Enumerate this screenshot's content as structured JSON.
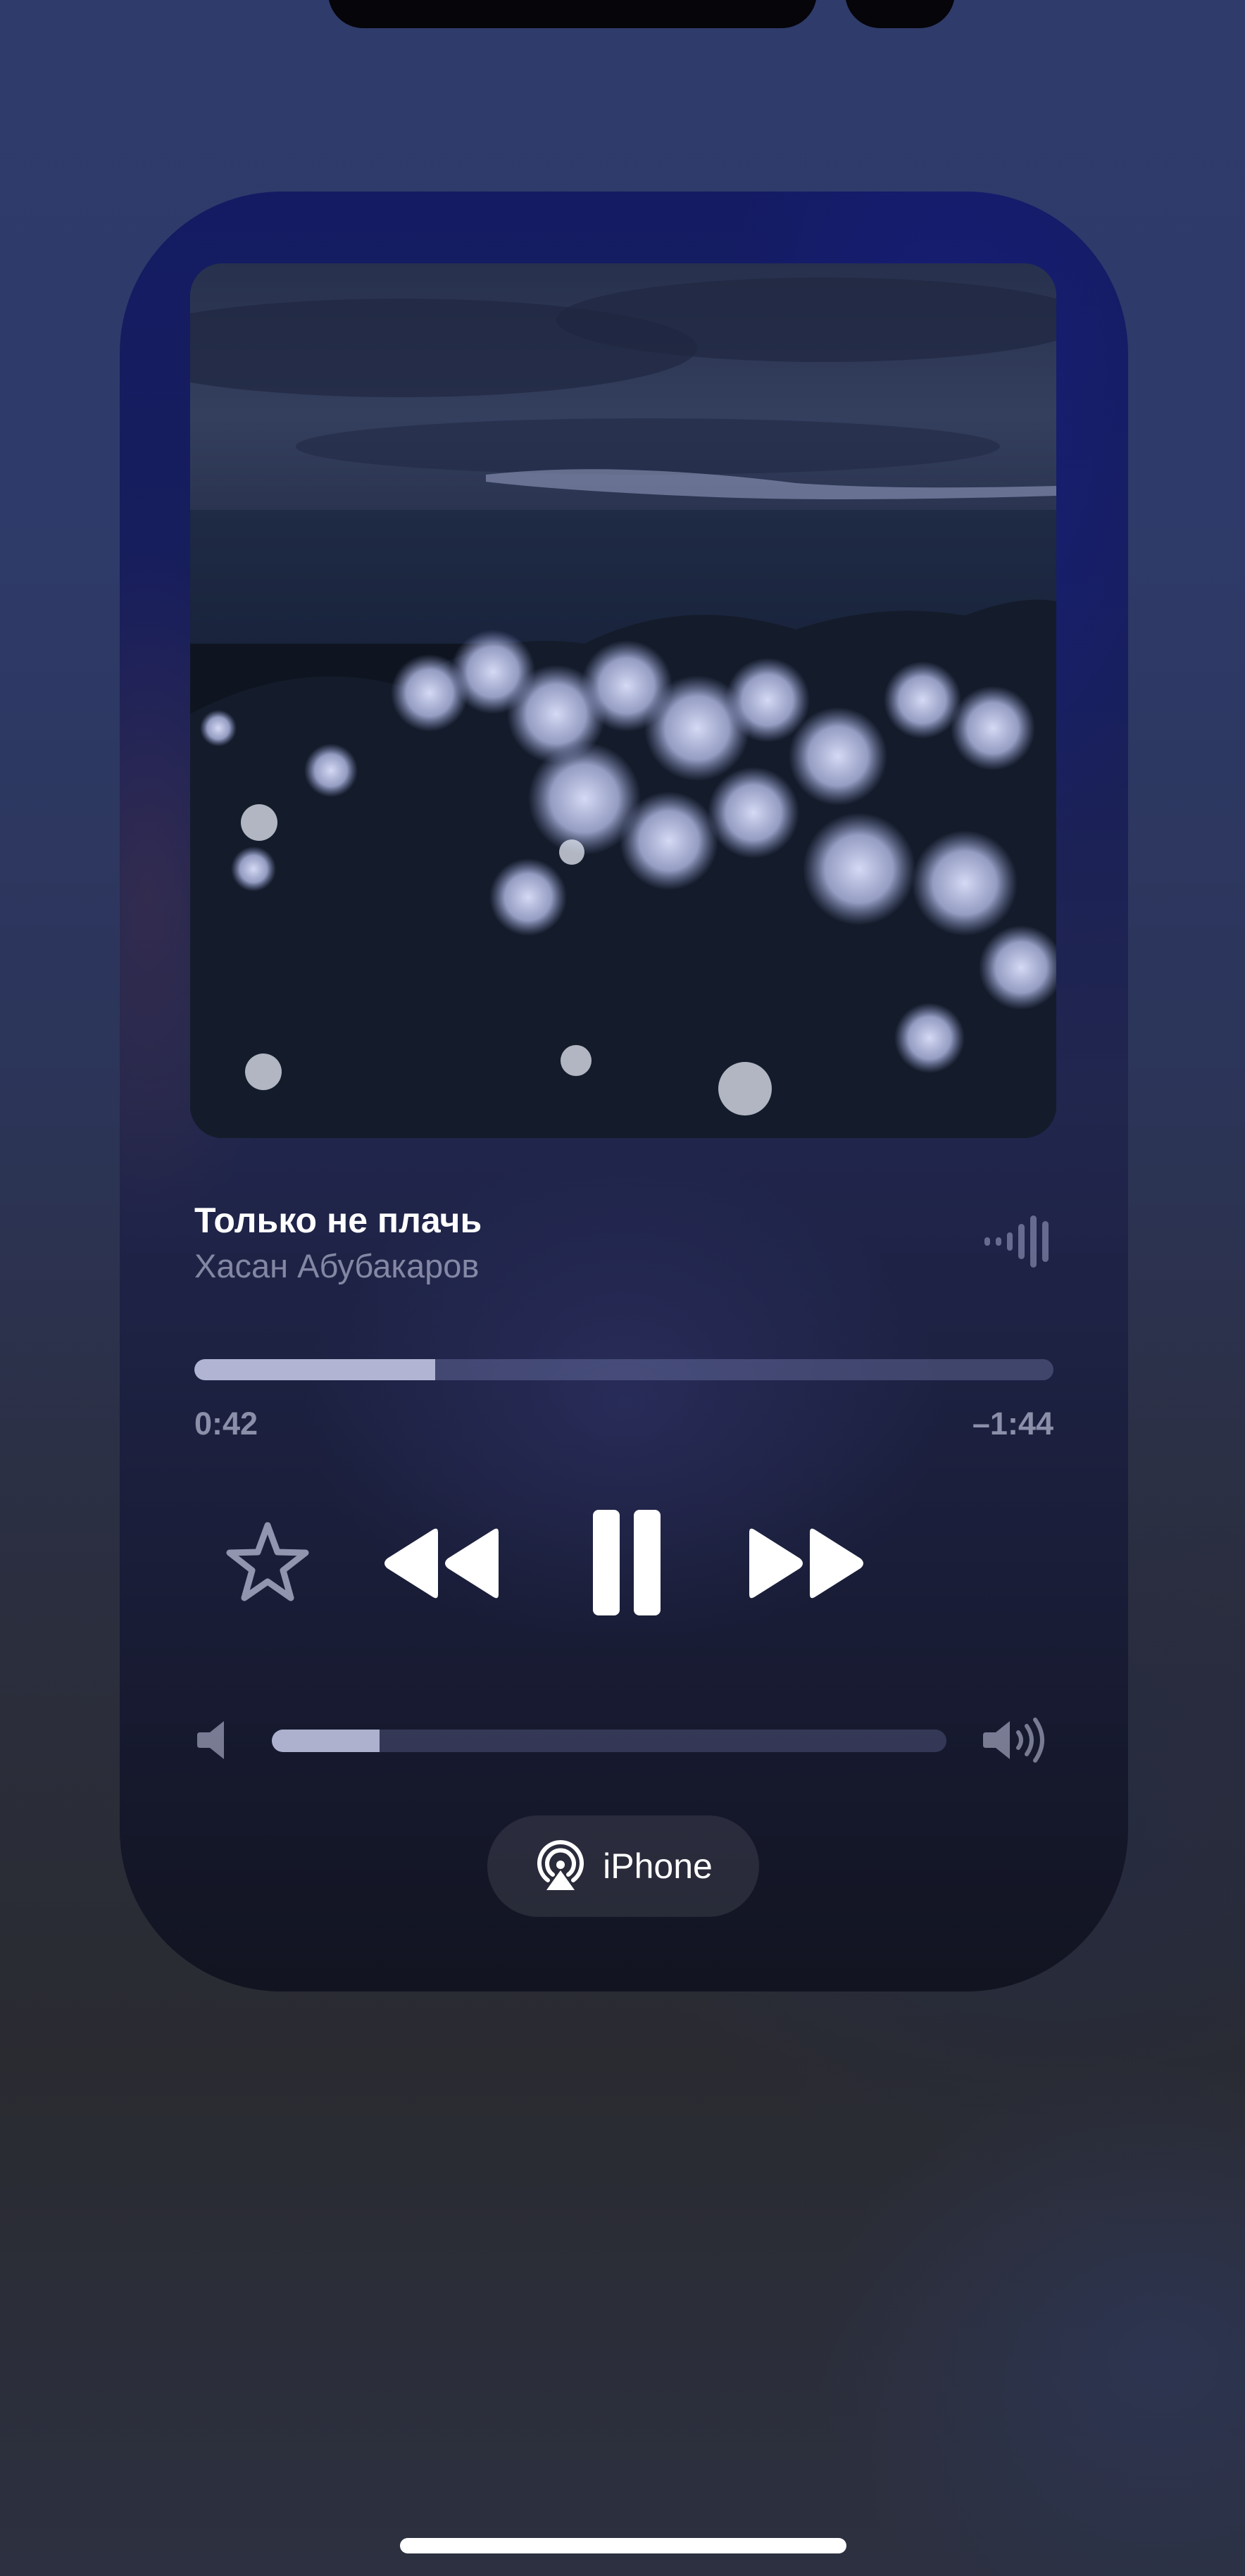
{
  "track": {
    "title": "Только не плачь",
    "artist": "Хасан Абубакаров"
  },
  "playback": {
    "elapsed": "0:42",
    "remaining": "–1:44",
    "progress": 0.28,
    "state": "playing"
  },
  "volume": {
    "level": 0.16
  },
  "output": {
    "device_label": "iPhone"
  },
  "icons": {
    "favorite": "star-icon",
    "rewind": "rewind-icon",
    "pause": "pause-icon",
    "forward": "fast-forward-icon",
    "volume_low": "speaker-low-icon",
    "volume_high": "speaker-high-icon",
    "airplay": "airplay-icon",
    "playing_indicator": "waveform-icon"
  },
  "colors": {
    "card_top": "#141b63",
    "progress_fill": "#b1b5d3",
    "text_primary": "#ffffff"
  }
}
